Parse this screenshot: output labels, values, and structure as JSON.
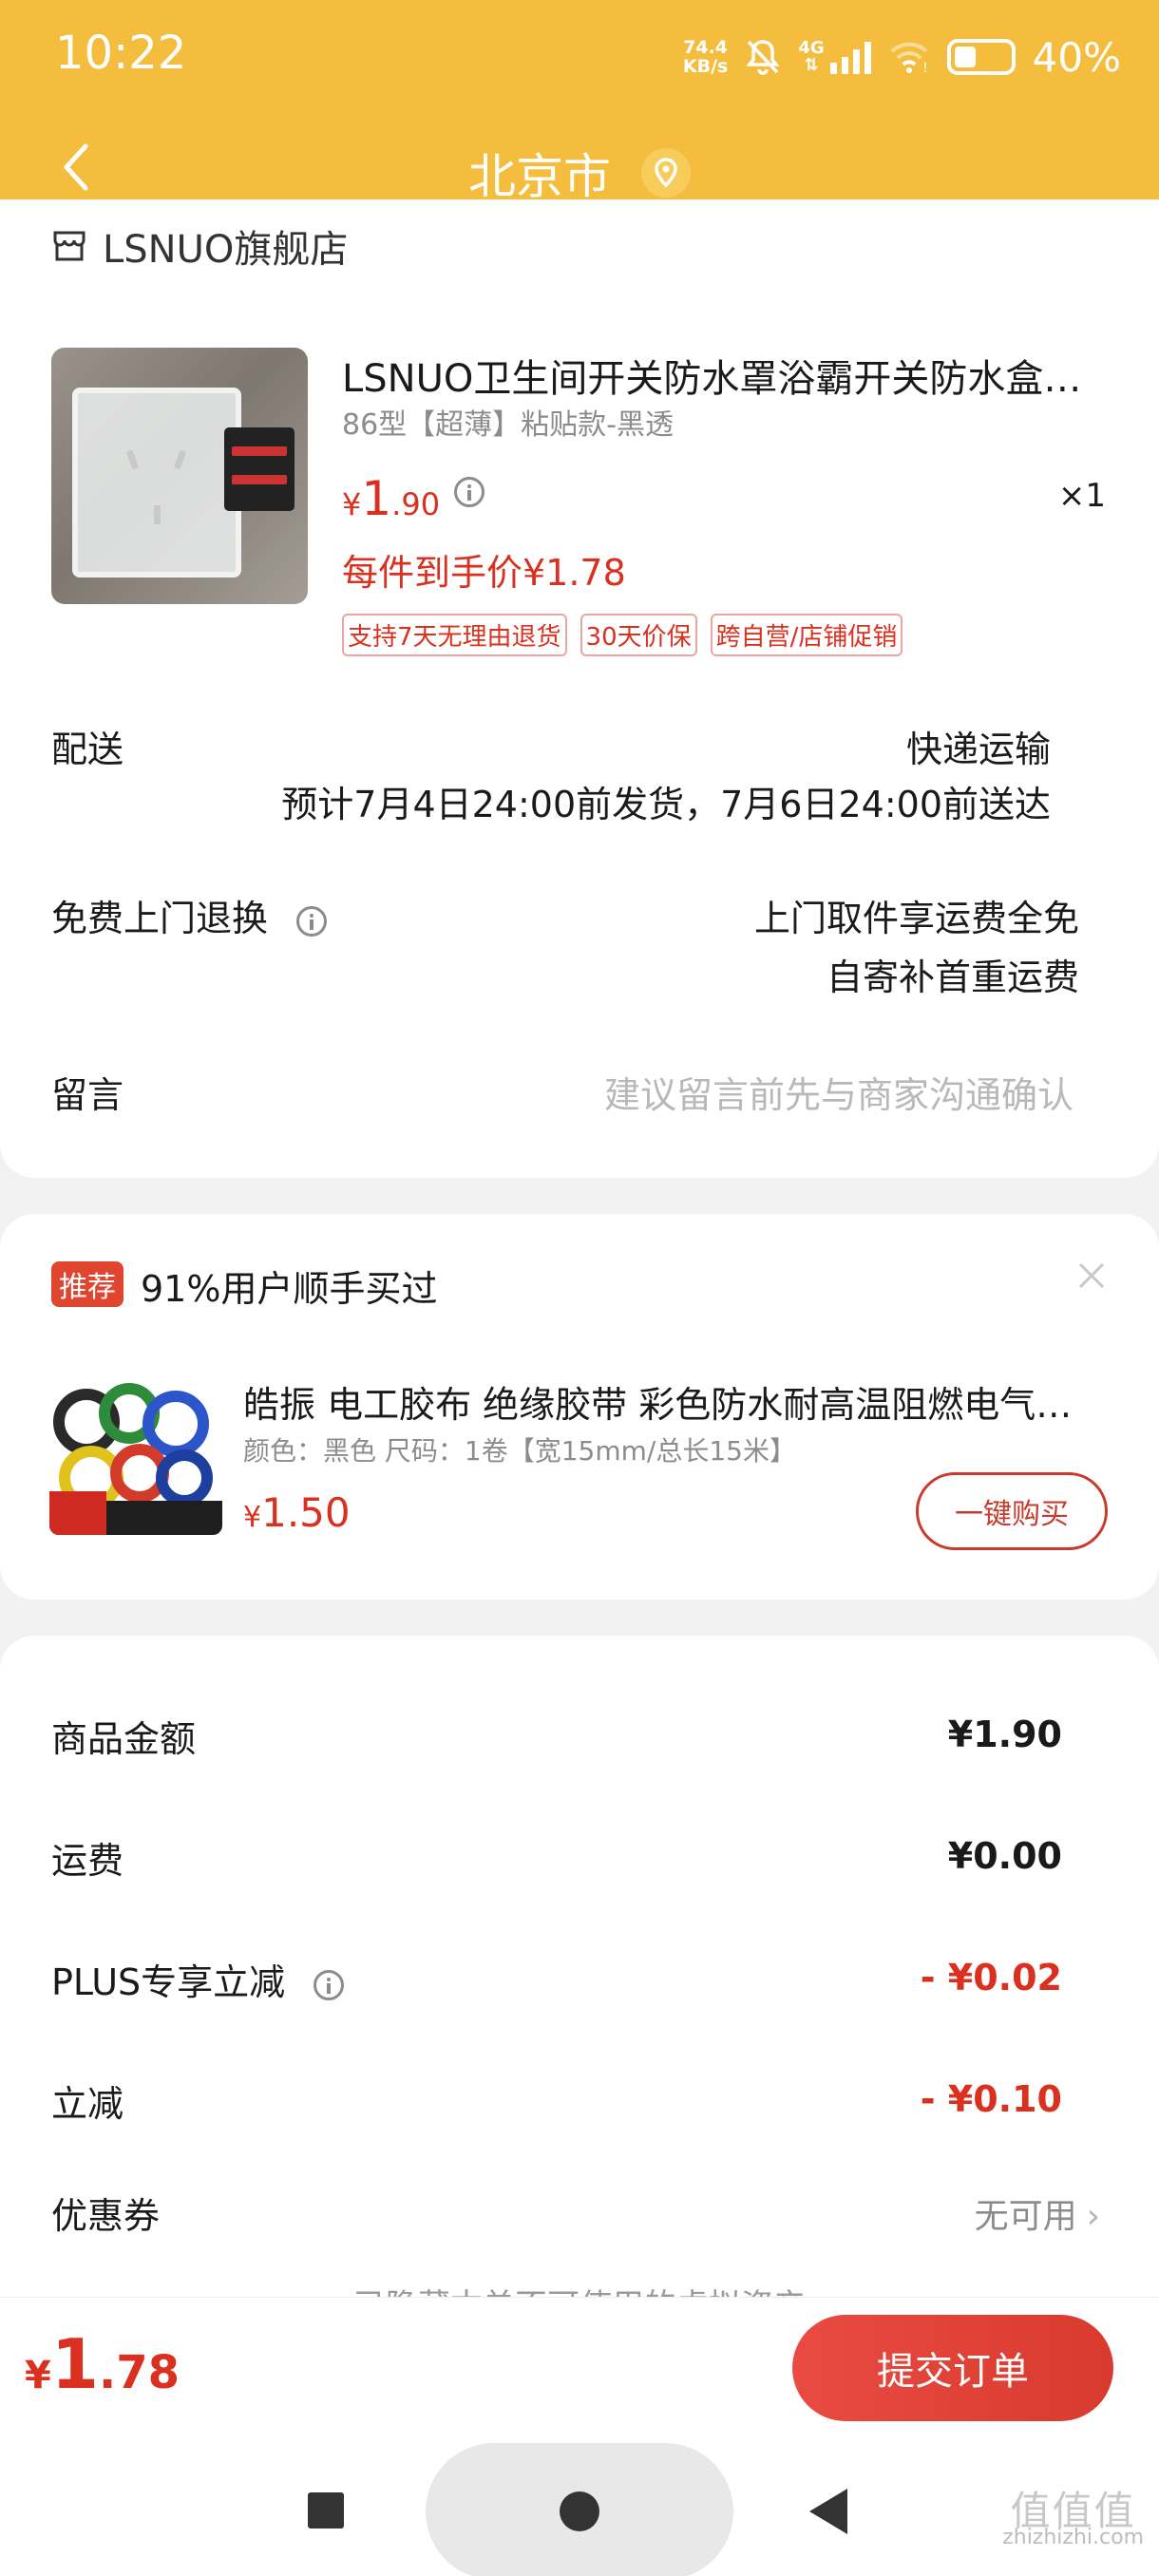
{
  "status_bar": {
    "time": "10:22",
    "net_speed_value": "74.4",
    "net_speed_unit": "KB/s",
    "network": "4G",
    "battery": "40%"
  },
  "header": {
    "title": "北京市"
  },
  "order": {
    "store_name": "LSNUO旗舰店",
    "product": {
      "title": "LSNUO卫生间开关防水罩浴霸开关防水盒厕所家用插座防溅盒",
      "spec": "86型【超薄】粘贴款-黑透",
      "price_currency": "¥",
      "price_int": "1",
      "price_dec": ".90",
      "quantity": "×1",
      "net_price": "每件到手价¥1.78",
      "tags": [
        "支持7天无理由退货",
        "30天价保",
        "跨自营/店铺促销"
      ]
    },
    "delivery": {
      "label": "配送",
      "method": "快递运输",
      "estimate": "预计7月4日24:00前发货，7月6日24:00前送达"
    },
    "return": {
      "label": "免费上门退换",
      "line1": "上门取件享运费全免",
      "line2": "自寄补首重运费"
    },
    "message": {
      "label": "留言",
      "placeholder": "建议留言前先与商家沟通确认"
    }
  },
  "recommend": {
    "badge": "推荐",
    "title": "91%用户顺手买过",
    "product_title": "皓振 电工胶布 绝缘胶带 彩色防水耐高温阻燃电气胶布",
    "spec": "颜色：黑色    尺码：1卷【宽15mm/总长15米】",
    "price_currency": "¥",
    "price_value": "1.50",
    "buy_label": "一键购买"
  },
  "summary": {
    "rows": [
      {
        "label": "商品金额",
        "value": "¥1.90"
      },
      {
        "label": "运费",
        "value": "¥0.00"
      },
      {
        "label": "PLUS专享立减",
        "value": "- ¥0.02"
      },
      {
        "label": "立减",
        "value": "- ¥0.10"
      }
    ],
    "coupon_label": "优惠券",
    "coupon_value": "无可用",
    "hidden_note": "已隐藏本单不可使用的虚拟资产"
  },
  "footer": {
    "total_currency": "¥",
    "total_int": "1",
    "total_dec": ".78",
    "submit_label": "提交订单"
  },
  "watermark": {
    "line1": "值值值",
    "line2": "zhizhizhi.com"
  },
  "colors": {
    "header_bg": "#f5bd3e",
    "price_red": "#d9301f",
    "submit_btn": "#e2443a"
  }
}
